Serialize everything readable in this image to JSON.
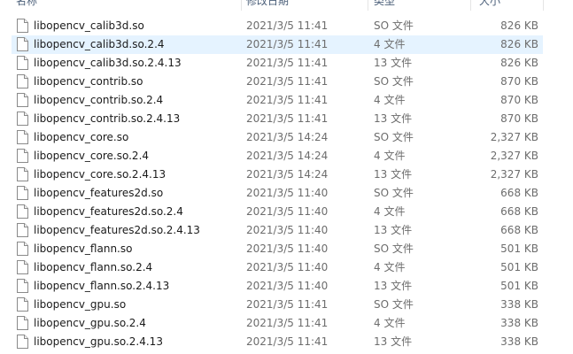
{
  "columns": {
    "name": "名称",
    "date": "修改日期",
    "type": "类型",
    "size": "大小"
  },
  "files": [
    {
      "name": "libopencv_calib3d.so",
      "date": "2021/3/5 11:41",
      "type": "SO 文件",
      "size": "826 KB"
    },
    {
      "name": "libopencv_calib3d.so.2.4",
      "date": "2021/3/5 11:41",
      "type": "4 文件",
      "size": "826 KB",
      "selected": true
    },
    {
      "name": "libopencv_calib3d.so.2.4.13",
      "date": "2021/3/5 11:41",
      "type": "13 文件",
      "size": "826 KB"
    },
    {
      "name": "libopencv_contrib.so",
      "date": "2021/3/5 11:41",
      "type": "SO 文件",
      "size": "870 KB"
    },
    {
      "name": "libopencv_contrib.so.2.4",
      "date": "2021/3/5 11:41",
      "type": "4 文件",
      "size": "870 KB"
    },
    {
      "name": "libopencv_contrib.so.2.4.13",
      "date": "2021/3/5 11:41",
      "type": "13 文件",
      "size": "870 KB"
    },
    {
      "name": "libopencv_core.so",
      "date": "2021/3/5 14:24",
      "type": "SO 文件",
      "size": "2,327 KB"
    },
    {
      "name": "libopencv_core.so.2.4",
      "date": "2021/3/5 14:24",
      "type": "4 文件",
      "size": "2,327 KB"
    },
    {
      "name": "libopencv_core.so.2.4.13",
      "date": "2021/3/5 14:24",
      "type": "13 文件",
      "size": "2,327 KB"
    },
    {
      "name": "libopencv_features2d.so",
      "date": "2021/3/5 11:40",
      "type": "SO 文件",
      "size": "668 KB"
    },
    {
      "name": "libopencv_features2d.so.2.4",
      "date": "2021/3/5 11:40",
      "type": "4 文件",
      "size": "668 KB"
    },
    {
      "name": "libopencv_features2d.so.2.4.13",
      "date": "2021/3/5 11:40",
      "type": "13 文件",
      "size": "668 KB"
    },
    {
      "name": "libopencv_flann.so",
      "date": "2021/3/5 11:40",
      "type": "SO 文件",
      "size": "501 KB"
    },
    {
      "name": "libopencv_flann.so.2.4",
      "date": "2021/3/5 11:40",
      "type": "4 文件",
      "size": "501 KB"
    },
    {
      "name": "libopencv_flann.so.2.4.13",
      "date": "2021/3/5 11:40",
      "type": "13 文件",
      "size": "501 KB"
    },
    {
      "name": "libopencv_gpu.so",
      "date": "2021/3/5 11:41",
      "type": "SO 文件",
      "size": "338 KB"
    },
    {
      "name": "libopencv_gpu.so.2.4",
      "date": "2021/3/5 11:41",
      "type": "4 文件",
      "size": "338 KB"
    },
    {
      "name": "libopencv_gpu.so.2.4.13",
      "date": "2021/3/5 11:41",
      "type": "13 文件",
      "size": "338 KB"
    }
  ],
  "icon": "generic-file-icon",
  "colors": {
    "selection": "#e5f3ff",
    "header_text": "#4c607a",
    "secondary_text": "#6d6d6d"
  }
}
